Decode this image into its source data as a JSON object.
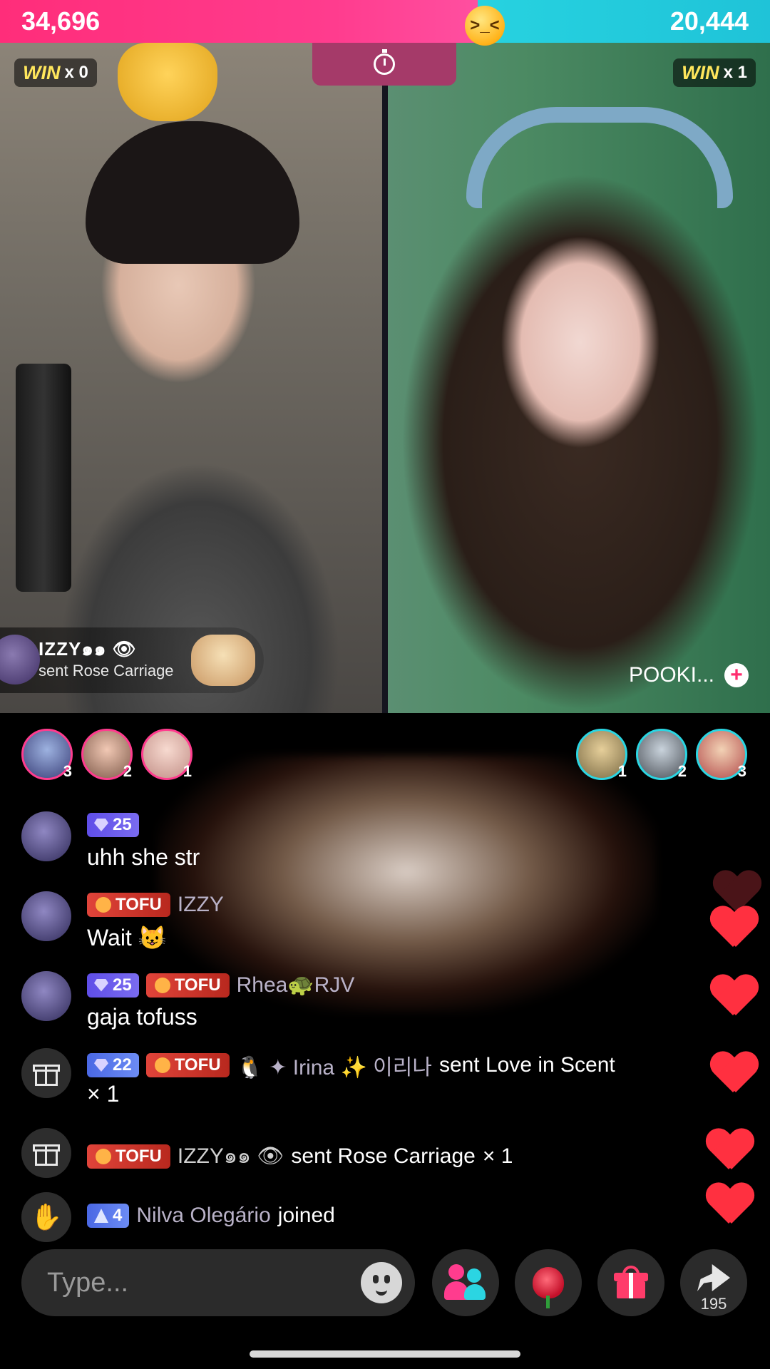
{
  "battle": {
    "left_score": "34,696",
    "right_score": "20,444",
    "left_win_label": "WIN",
    "left_win_count": "x 0",
    "right_win_label": "WIN",
    "right_win_count": "x 1",
    "marker_emoji": ">_<"
  },
  "gift_popup": {
    "user": "IZZY๑๑ 👁",
    "text": "sent Rose Carriage"
  },
  "opponent": {
    "name": "POOKI...",
    "follow_symbol": "+"
  },
  "supporters_left": [
    {
      "rank": "3"
    },
    {
      "rank": "2"
    },
    {
      "rank": "1"
    }
  ],
  "supporters_right": [
    {
      "rank": "1"
    },
    {
      "rank": "2"
    },
    {
      "rank": "3"
    }
  ],
  "chat": [
    {
      "level": "25",
      "tofu": "",
      "name": "",
      "text": "uhh she str"
    },
    {
      "level": "",
      "tofu": "TOFU",
      "name": "IZZY",
      "text": "Wait 😺"
    },
    {
      "level": "25",
      "tofu": "TOFU",
      "name": "Rhea🐢RJV",
      "text": "gaja tofuss"
    },
    {
      "level": "22",
      "tofu": "TOFU",
      "name": "🐧 ✦ Irina ✨ 이리나",
      "text": "sent Love in Scent",
      "text2": "× 1"
    },
    {
      "level": "",
      "tofu": "TOFU",
      "name": "IZZY๑๑ 👁",
      "text": "sent Rose Carriage",
      "suffix": "× 1"
    },
    {
      "level": "4",
      "tofu": "",
      "name": "Nilva Olegário",
      "text": "joined"
    }
  ],
  "input": {
    "placeholder": "Type..."
  },
  "share": {
    "count": "195"
  },
  "icons": {
    "emoji": "emoji-icon",
    "guests": "guests-icon",
    "rose": "rose-icon",
    "gift": "gift-icon",
    "share": "share-icon"
  },
  "colors": {
    "left_team": "#ff3c8e",
    "right_team": "#27d2e0",
    "tofu_badge": "#d0362c",
    "level_badge": "#6657ec",
    "heart": "#ff3040"
  }
}
